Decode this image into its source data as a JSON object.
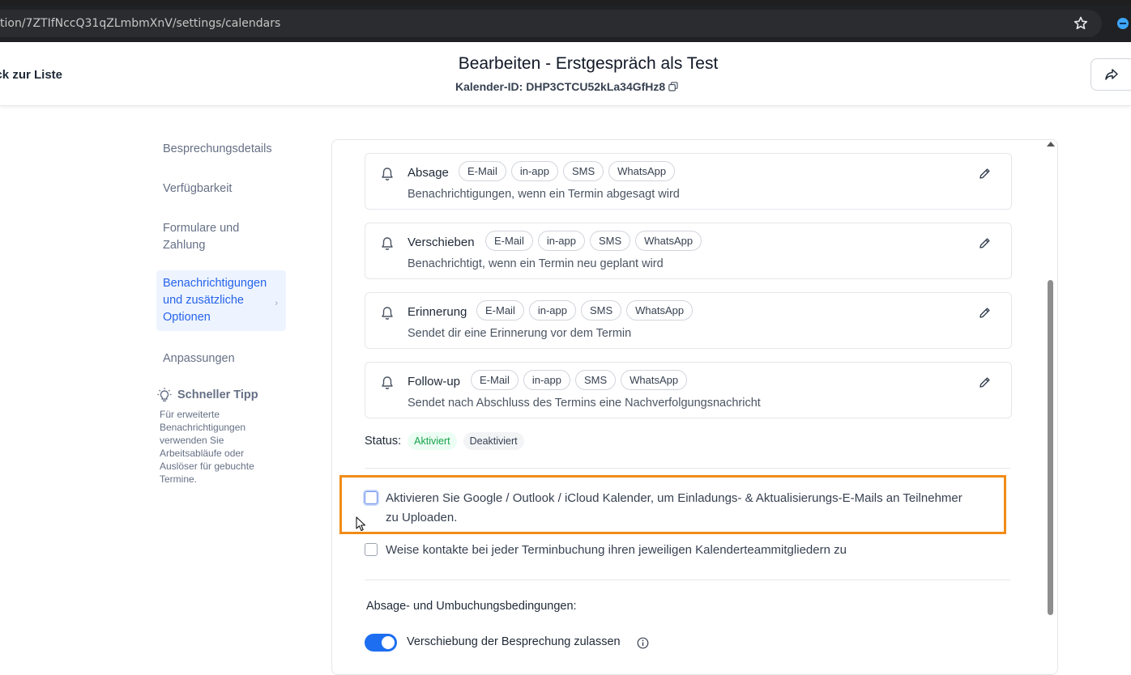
{
  "browser": {
    "url": "tion/7ZTIfNccQ31qZLmbmXnV/settings/calendars"
  },
  "header": {
    "back_label": "ck zur Liste",
    "title": "Bearbeiten - Erstgespräch als Test",
    "calendar_id_label": "Kalender-ID:",
    "calendar_id_value": "DHP3CTCU52kLa34GfHz8"
  },
  "sidebar": {
    "items": [
      {
        "label": "Besprechungsdetails"
      },
      {
        "label": "Verfügbarkeit"
      },
      {
        "label": "Formulare und Zahlung"
      },
      {
        "label": "Benachrichtigungen und zusätzliche Optionen",
        "active": true
      },
      {
        "label": "Anpassungen"
      }
    ],
    "tip_title": "Schneller Tipp",
    "tip_text": "Für erweiterte Benachrichtigungen verwenden Sie Arbeitsabläufe oder Auslöser für gebuchte Termine."
  },
  "notifications": [
    {
      "title": "Absage",
      "channels": [
        "E-Mail",
        "in-app",
        "SMS",
        "WhatsApp"
      ],
      "description": "Benachrichtigungen, wenn ein Termin abgesagt wird"
    },
    {
      "title": "Verschieben",
      "channels": [
        "E-Mail",
        "in-app",
        "SMS",
        "WhatsApp"
      ],
      "description": "Benachrichtigt, wenn ein Termin neu geplant wird"
    },
    {
      "title": "Erinnerung",
      "channels": [
        "E-Mail",
        "in-app",
        "SMS",
        "WhatsApp"
      ],
      "description": "Sendet dir eine Erinnerung vor dem Termin"
    },
    {
      "title": "Follow-up",
      "channels": [
        "E-Mail",
        "in-app",
        "SMS",
        "WhatsApp"
      ],
      "description": "Sendet nach Abschluss des Termins eine Nachverfolgungsnachricht"
    }
  ],
  "status": {
    "label": "Status:",
    "active": "Aktiviert",
    "inactive": "Deaktiviert"
  },
  "options": {
    "calendar_sync_line1": "Aktivieren Sie Google / Outlook / iCloud Kalender, um Einladungs- & Aktualisierungs-E-Mails an Teilnehmer",
    "calendar_sync_line2": "zu Uploaden.",
    "calendar_sync_checked": false,
    "assign_contacts": "Weise kontakte bei jeder Terminbuchung ihren jeweiligen Kalenderteammitgliedern zu",
    "assign_contacts_checked": false
  },
  "cancellation": {
    "section_title": "Absage- und Umbuchungsbedingungen:",
    "allow_reschedule_label": "Verschiebung der Besprechung zulassen",
    "allow_reschedule_on": true
  },
  "colors": {
    "accent": "#1d6ef0",
    "highlight": "#f08c18",
    "active_badge": "#16a34a"
  }
}
